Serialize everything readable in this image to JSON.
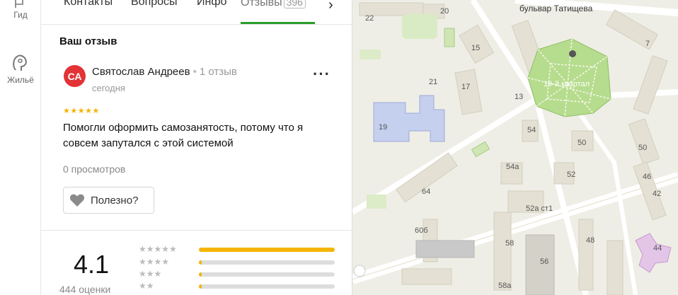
{
  "rail": {
    "items": [
      {
        "label": "Гид",
        "icon": "guide-icon"
      },
      {
        "label": "Жильё",
        "icon": "housing-icon"
      }
    ]
  },
  "tabs": {
    "items": [
      "Контакты",
      "Вопросы",
      "Инфо",
      "Отзывы"
    ],
    "reviews_count": "396",
    "active": "Отзывы"
  },
  "review": {
    "section_title": "Ваш отзыв",
    "avatar_initials": "СА",
    "author": "Святослав Андреев",
    "author_reviews": "1 отзыв",
    "date": "сегодня",
    "stars": "★★★★★",
    "text": "Помогли оформить самозанятость, потому что я совсем запутался с этой системой",
    "views": "0 просмотров",
    "useful_label": "Полезно?"
  },
  "summary": {
    "rating": "4.1",
    "count": "444 оценки",
    "bars": [
      {
        "stars": "★★★★★",
        "fraction": 1.0
      },
      {
        "stars": "★★★★",
        "fraction": 0.02
      },
      {
        "stars": "★★★",
        "fraction": 0.02
      },
      {
        "stars": "★★",
        "fraction": 0.02
      }
    ]
  },
  "map": {
    "street": "бульвар Татищева",
    "park_label": "19-й квартал",
    "labels": [
      "22",
      "20",
      "15",
      "7",
      "21",
      "17",
      "13",
      "19",
      "54",
      "50",
      "50",
      "54а",
      "52",
      "64",
      "46",
      "42",
      "52а ст1",
      "60б",
      "58",
      "56",
      "48",
      "44",
      "58а"
    ]
  },
  "colors": {
    "accent_green": "#2a9d2a",
    "star": "#f5b400",
    "avatar": "#e23336"
  }
}
